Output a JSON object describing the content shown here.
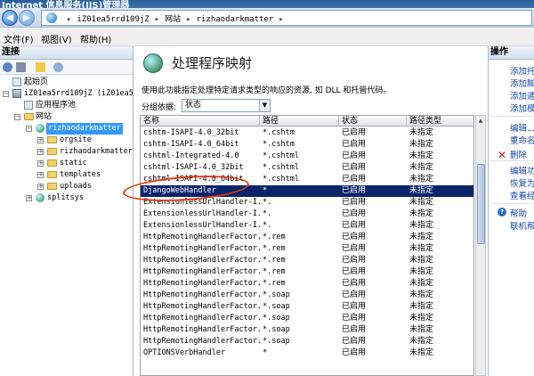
{
  "window": {
    "title": "Internet 信息服务(IIS)管理器"
  },
  "address": {
    "crumbs": [
      "iZ01ea5rrd109jZ",
      "网站",
      "rizhaodarkmatter"
    ]
  },
  "menu": {
    "items": [
      "文件(F)",
      "视图(V)",
      "帮助(H)"
    ]
  },
  "connections": {
    "title": "连接",
    "tree": {
      "start": "起始页",
      "server": "iZ01ea5rrd109jZ (iZ01ea5rrd",
      "app_pools": "应用程序池",
      "sites": "网站",
      "site": "rizhaodarkmatter",
      "children": [
        "orgsite",
        "rizhaodarkmatter",
        "static",
        "templates",
        "uploads"
      ],
      "splitsys": "splitsys"
    }
  },
  "main": {
    "title": "处理程序映射",
    "description": "使用此功能指定处理特定请求类型的响应的资源, 如 DLL 和托管代码。",
    "group_label": "分组依据:",
    "group_value": "状态",
    "columns": [
      "名称",
      "路径",
      "状态",
      "路径类型"
    ],
    "rows": [
      [
        "cshtm-ISAPI-4.0_32bit",
        "*.cshtm",
        "已启用",
        "未指定"
      ],
      [
        "cshtm-ISAPI-4.0_64bit",
        "*.cshtm",
        "已启用",
        "未指定"
      ],
      [
        "cshtml-Integrated-4.0",
        "*.cshtml",
        "已启用",
        "未指定"
      ],
      [
        "cshtml-ISAPI-4.0_32bit",
        "*.cshtml",
        "已启用",
        "未指定"
      ],
      [
        "cshtml-ISAPI-4.0_64bit",
        "*.cshtml",
        "已启用",
        "未指定"
      ],
      [
        "DjangoWebHandler",
        "*",
        "已启用",
        "未指定"
      ],
      [
        "ExtensionlessUrlHandler-I...",
        "*.",
        "已启用",
        "未指定"
      ],
      [
        "ExtensionlessUrlHandler-I...",
        "*.",
        "已启用",
        "未指定"
      ],
      [
        "ExtensionlessUrlHandler-I...",
        "*.",
        "已启用",
        "未指定"
      ],
      [
        "HttpRemotingHandlerFactor...",
        "*.rem",
        "已启用",
        "未指定"
      ],
      [
        "HttpRemotingHandlerFactor...",
        "*.rem",
        "已启用",
        "未指定"
      ],
      [
        "HttpRemotingHandlerFactor...",
        "*.rem",
        "已启用",
        "未指定"
      ],
      [
        "HttpRemotingHandlerFactor...",
        "*.rem",
        "已启用",
        "未指定"
      ],
      [
        "HttpRemotingHandlerFactor...",
        "*.rem",
        "已启用",
        "未指定"
      ],
      [
        "HttpRemotingHandlerFactor...",
        "*.soap",
        "已启用",
        "未指定"
      ],
      [
        "HttpRemotingHandlerFactor...",
        "*.soap",
        "已启用",
        "未指定"
      ],
      [
        "HttpRemotingHandlerFactor...",
        "*.soap",
        "已启用",
        "未指定"
      ],
      [
        "HttpRemotingHandlerFactor...",
        "*.soap",
        "已启用",
        "未指定"
      ],
      [
        "HttpRemotingHandlerFactor...",
        "*.soap",
        "已启用",
        "未指定"
      ],
      [
        "OPTIONSVerbHandler",
        "*",
        "已启用",
        "未指定"
      ]
    ],
    "selected_row": 5
  },
  "actions": {
    "title": "操作",
    "items": [
      "添加托",
      "添加脚",
      "添加通",
      "添加模",
      "编辑...",
      "重命名",
      "删除",
      "编辑功",
      "恢复为",
      "查看经",
      "帮助",
      "联机帮"
    ]
  },
  "colors": {
    "selection": "#0a246a",
    "highlight_ring": "#e03a10",
    "link": "#1545a8"
  }
}
